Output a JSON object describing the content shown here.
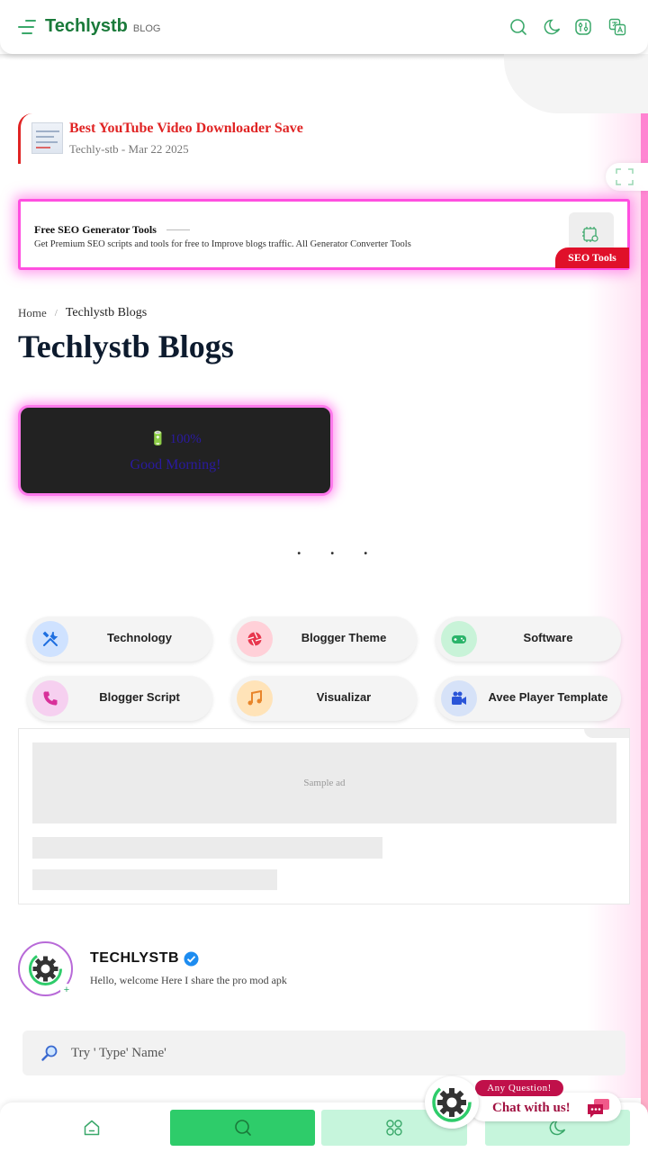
{
  "header": {
    "brand": "Techlystb",
    "brand_tag": "BLOG",
    "icons": [
      "menu-icon",
      "search-icon",
      "moon-icon",
      "settings-icon",
      "translate-icon"
    ]
  },
  "featured_post": {
    "title": "Best YouTube Video Downloader Save",
    "meta": "Techly-stb - Mar 22 2025"
  },
  "seo_card": {
    "title": "Free SEO Generator Tools",
    "description": "Get Premium SEO scripts and tools for free to Improve blogs traffic. All Generator Converter Tools",
    "badge": "SEO Tools"
  },
  "breadcrumb": {
    "home": "Home",
    "separator": "/",
    "current": "Techlystb Blogs"
  },
  "page_title": "Techlystb Blogs",
  "greeting": {
    "battery_icon": "🔋",
    "battery": "100%",
    "message": "Good Morning!"
  },
  "loading_dots": ". . .",
  "categories": [
    {
      "label": "Technology",
      "icon": "tools-icon",
      "color": "#cfe2ff"
    },
    {
      "label": "Blogger Theme",
      "icon": "aperture-icon",
      "color": "#ffd0d8"
    },
    {
      "label": "Software",
      "icon": "gamepad-icon",
      "color": "#c8f3d8"
    },
    {
      "label": "Blogger Script",
      "icon": "phone-icon",
      "color": "#f6d0f0"
    },
    {
      "label": "Visualizar",
      "icon": "music-icon",
      "color": "#ffe3b8"
    },
    {
      "label": "Avee Player Template",
      "icon": "video-camera-icon",
      "color": "#d6e2f8"
    }
  ],
  "ad": {
    "sample_text": "Sample ad"
  },
  "profile": {
    "name": "TECHLYSTB",
    "bio": "Hello, welcome Here I share the pro mod apk",
    "plus": "+"
  },
  "search": {
    "placeholder": "Try ' Type' Name'"
  },
  "bottom_nav": [
    {
      "name": "home",
      "color": "#ffffff"
    },
    {
      "name": "search",
      "color": "#2ecc6a"
    },
    {
      "name": "apps",
      "color": "#c6f5dc"
    },
    {
      "name": "theme",
      "color": "#c6f5dc"
    }
  ],
  "chat_widget": {
    "badge": "Any Question!",
    "label": "Chat with us!"
  },
  "colors": {
    "brand_green": "#1a7a3a",
    "accent_red": "#e02424",
    "neon_pink": "#ff4fe0"
  }
}
